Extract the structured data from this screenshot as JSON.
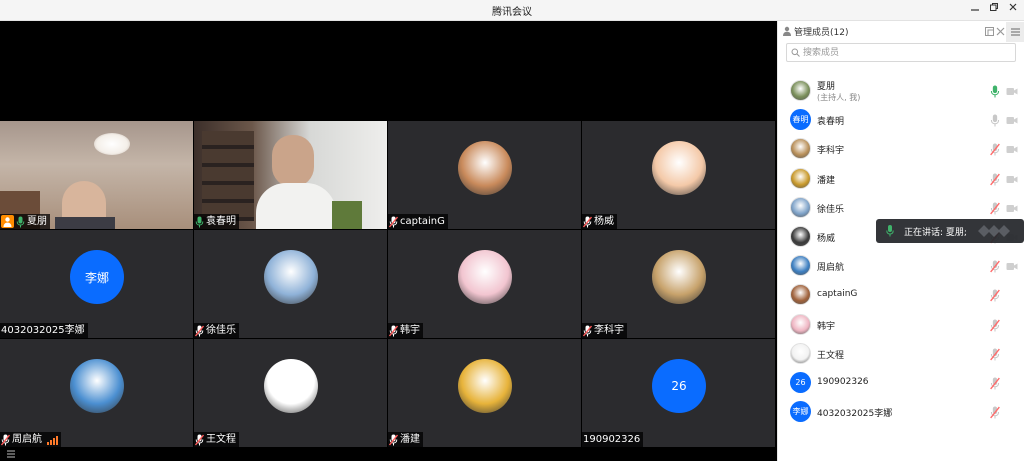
{
  "window": {
    "title": "腾讯会议"
  },
  "tiles": [
    {
      "name": "夏朋",
      "kind": "camera",
      "scene": "cam1",
      "active": true,
      "host": true,
      "mic": "on"
    },
    {
      "name": "袁春明",
      "kind": "camera",
      "scene": "cam2",
      "active": false,
      "host": false,
      "mic": "on"
    },
    {
      "name": "captainG",
      "kind": "avatar",
      "color": "#c98a5b",
      "mic": "off"
    },
    {
      "name": "杨威",
      "kind": "avatar",
      "color": "#f4c9a8",
      "mic": "off"
    },
    {
      "name": "4032032025李娜",
      "kind": "initials",
      "initials": "李娜",
      "mic": "none"
    },
    {
      "name": "徐佳乐",
      "kind": "avatar",
      "color": "#8fb2d8",
      "mic": "off"
    },
    {
      "name": "韩宇",
      "kind": "avatar",
      "color": "#f2c5d0",
      "mic": "off"
    },
    {
      "name": "李科宇",
      "kind": "avatar",
      "color": "#c7a26b",
      "mic": "off"
    },
    {
      "name": "周启航",
      "kind": "avatar",
      "color": "#4b8fd1",
      "mic": "off",
      "signal": true
    },
    {
      "name": "王文程",
      "kind": "avatar",
      "color": "#ffffff",
      "mic": "off"
    },
    {
      "name": "潘建",
      "kind": "avatar",
      "color": "#e7b33a",
      "mic": "off"
    },
    {
      "name": "190902326",
      "kind": "initials",
      "initials": "26",
      "mic": "none"
    }
  ],
  "sidebar": {
    "title": "管理成员(12)",
    "search_placeholder": "搜索成员",
    "members": [
      {
        "name": "夏朋",
        "sub": "(主持人, 我)",
        "avatar_color": "#7a8f5a",
        "mic": "on",
        "cam": true
      },
      {
        "name": "袁春明",
        "initials": "春明",
        "avatar_color": "#0a6cff",
        "mic": "idle",
        "cam": true
      },
      {
        "name": "李科宇",
        "avatar_color": "#b9905a",
        "mic": "off",
        "cam": true
      },
      {
        "name": "潘建",
        "avatar_color": "#c99a2c",
        "mic": "off",
        "cam": true
      },
      {
        "name": "徐佳乐",
        "avatar_color": "#7fa3c9",
        "mic": "off",
        "cam": true
      },
      {
        "name": "杨威",
        "avatar_color": "#3a3a3a",
        "mic": "off",
        "cam": true
      },
      {
        "name": "周启航",
        "avatar_color": "#3d7fc1",
        "mic": "off",
        "cam": true
      },
      {
        "name": "captainG",
        "avatar_color": "#a0623b",
        "mic": "off",
        "cam": false
      },
      {
        "name": "韩宇",
        "avatar_color": "#efb6c3",
        "mic": "off",
        "cam": false
      },
      {
        "name": "王文程",
        "avatar_color": "#f2f2f2",
        "mic": "off",
        "cam": false
      },
      {
        "name": "190902326",
        "initials": "26",
        "avatar_color": "#0a6cff",
        "mic": "off",
        "cam": false
      },
      {
        "name": "4032032025李娜",
        "initials": "李娜",
        "avatar_color": "#0a6cff",
        "mic": "off",
        "cam": false
      }
    ]
  },
  "toast": {
    "text": "正在讲话: 夏朋;"
  },
  "colors": {
    "accent": "#0a6cff",
    "mic_on": "#3fb36b",
    "mic_off": "#ff5a5a",
    "host": "#ff8c00"
  }
}
